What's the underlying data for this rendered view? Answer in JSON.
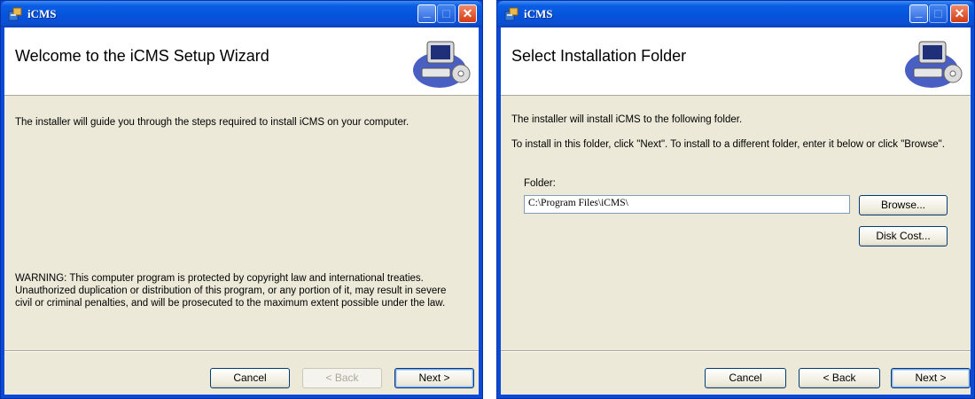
{
  "left_window": {
    "title": "iCMS",
    "header": "Welcome to the iCMS Setup Wizard",
    "intro": "The installer will guide you through the steps required to install iCMS on your computer.",
    "warning": "WARNING: This computer program is protected by copyright law and international treaties. Unauthorized duplication or distribution of this program, or any portion of it, may result in severe civil or criminal penalties, and will be prosecuted to the maximum extent possible under the law.",
    "buttons": {
      "cancel": "Cancel",
      "back": "< Back",
      "next": "Next >"
    }
  },
  "right_window": {
    "title": "iCMS",
    "header": "Select Installation Folder",
    "line1": "The installer will install iCMS to the following folder.",
    "line2": "To install in this folder, click \"Next\". To install to a different folder, enter it below or click \"Browse\".",
    "folder_label": "Folder:",
    "folder_value": "C:\\Program Files\\iCMS\\",
    "buttons": {
      "browse": "Browse...",
      "disk_cost": "Disk Cost...",
      "cancel": "Cancel",
      "back": "< Back",
      "next": "Next >"
    }
  },
  "colors": {
    "titlebar": "#0a5ee4",
    "dialog_bg": "#ece9d8",
    "close_button": "#d33b12"
  },
  "icons": [
    "installer-app-icon",
    "minimize-icon",
    "maximize-icon",
    "close-icon",
    "computer-disc-icon"
  ]
}
